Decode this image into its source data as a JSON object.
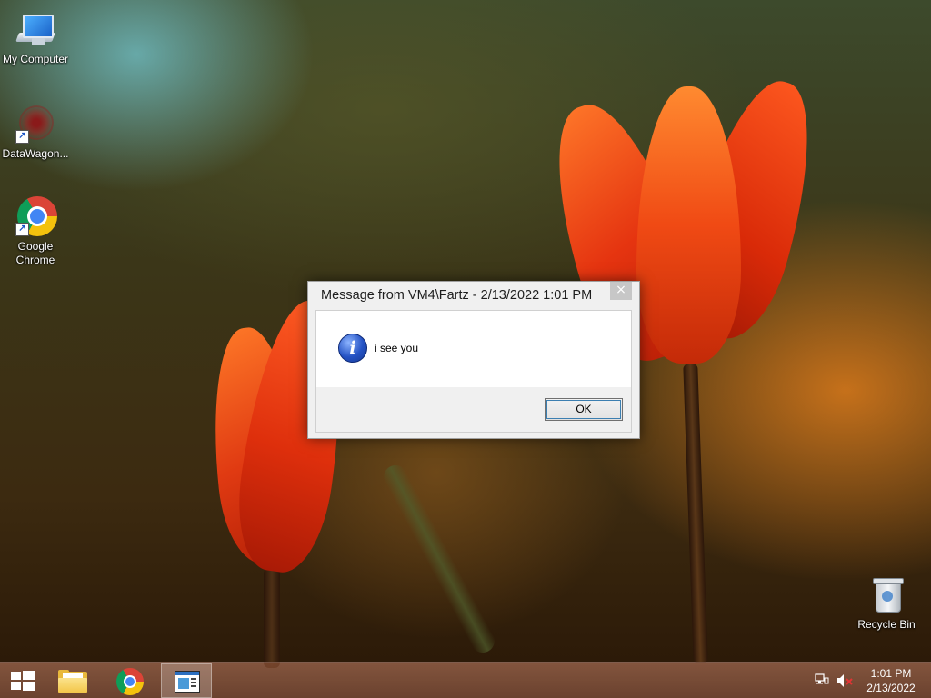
{
  "desktop": {
    "icons": [
      {
        "label": "My Computer",
        "icon": "my-computer-icon"
      },
      {
        "label": "DataWagon...",
        "icon": "datawagon-icon"
      },
      {
        "label": "Google Chrome",
        "icon": "chrome-icon"
      },
      {
        "label": "Recycle Bin",
        "icon": "recycle-bin-icon"
      }
    ]
  },
  "dialog": {
    "title": "Message from VM4\\Fartz - 2/13/2022 1:01 PM",
    "close_glyph": "×",
    "icon": "info-icon",
    "icon_glyph": "i",
    "message": "i see you",
    "ok_label": "OK"
  },
  "taskbar": {
    "pinned": [
      {
        "name": "file-explorer",
        "icon": "folder-icon"
      },
      {
        "name": "google-chrome",
        "icon": "chrome-icon"
      },
      {
        "name": "message-window",
        "icon": "window-icon",
        "active": true
      }
    ],
    "tray": {
      "network_icon": "network-icon",
      "volume_icon": "volume-muted-icon"
    },
    "clock": {
      "time": "1:01 PM",
      "date": "2/13/2022"
    }
  },
  "colors": {
    "taskbar": "#6f3f27",
    "dialog_bg": "#f0f0f0",
    "info_icon": "#2452c4"
  }
}
